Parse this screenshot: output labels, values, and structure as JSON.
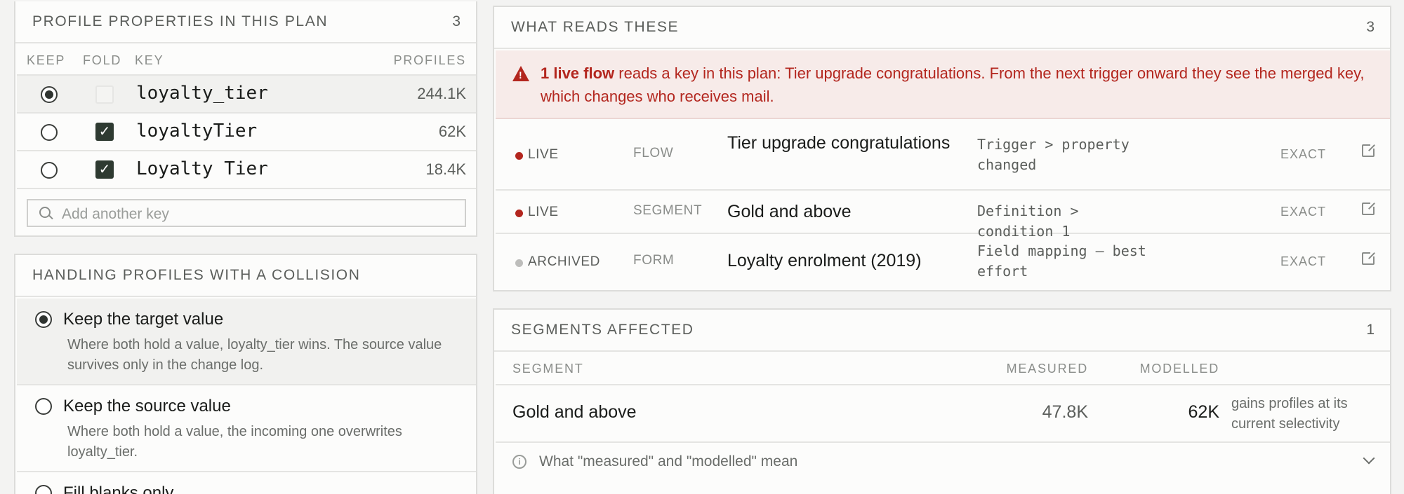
{
  "props_panel": {
    "title": "PROFILE PROPERTIES IN THIS PLAN",
    "count": "3",
    "columns": {
      "keep": "KEEP",
      "fold": "FOLD",
      "key": "KEY",
      "profiles": "PROFILES"
    },
    "rows": [
      {
        "key": "loyalty_tier",
        "profiles": "244.1K",
        "keep": true,
        "fold": false
      },
      {
        "key": "loyaltyTier",
        "profiles": "62K",
        "keep": false,
        "fold": true
      },
      {
        "key": "Loyalty Tier",
        "profiles": "18.4K",
        "keep": false,
        "fold": true
      }
    ],
    "add_placeholder": "Add another key"
  },
  "collision_panel": {
    "title": "HANDLING PROFILES WITH A COLLISION",
    "options": [
      {
        "label": "Keep the target value",
        "desc": "Where both hold a value, loyalty_tier wins. The source value survives only in the change log.",
        "selected": true
      },
      {
        "label": "Keep the source value",
        "desc": "Where both hold a value, the incoming one overwrites loyalty_tier.",
        "selected": false
      },
      {
        "label": "Fill blanks only",
        "desc": "",
        "selected": false
      }
    ]
  },
  "reads_panel": {
    "title": "WHAT READS THESE",
    "count": "3",
    "alert_strong": "1 live flow",
    "alert_rest": " reads a key in this plan: Tier upgrade congratulations. From the next trigger onward they see the merged key, which changes who receives mail.",
    "rows": [
      {
        "status": "LIVE",
        "kind": "FLOW",
        "name": "Tier upgrade congratulations",
        "path": "Trigger > property changed",
        "match": "EXACT",
        "status_color": "#b3261e"
      },
      {
        "status": "LIVE",
        "kind": "SEGMENT",
        "name": "Gold and above",
        "path": "Definition > condition 1",
        "match": "EXACT",
        "status_color": "#b3261e"
      },
      {
        "status": "ARCHIVED",
        "kind": "FORM",
        "name": "Loyalty enrolment (2019)",
        "path": "Field mapping — best effort",
        "match": "EXACT",
        "status_color": "#bdbdbb"
      }
    ]
  },
  "segments_panel": {
    "title": "SEGMENTS AFFECTED",
    "count": "1",
    "columns": {
      "segment": "SEGMENT",
      "measured": "MEASURED",
      "modelled": "MODELLED"
    },
    "rows": [
      {
        "segment": "Gold and above",
        "measured": "47.8K",
        "modelled": "62K",
        "note": "gains profiles at its current selectivity"
      }
    ],
    "explain": "What \"measured\" and \"modelled\" mean"
  },
  "colors": {
    "danger": "#b3261e",
    "check": "#2e3a31"
  }
}
